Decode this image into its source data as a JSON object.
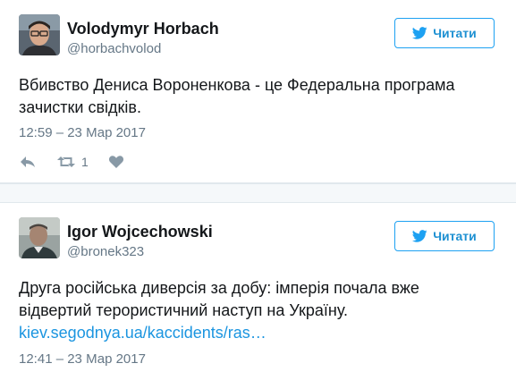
{
  "tweets": [
    {
      "display_name": "Volodymyr Horbach",
      "handle": "@horbachvolod",
      "follow_label": "Читати",
      "text": "Вбивство Дениса Вороненкова - це Федеральна програма зачистки свідків.",
      "link": "",
      "timestamp": "12:59 – 23 Мар 2017",
      "retweet_count": "1",
      "avatar_icon": "person-photo-avatar-icon"
    },
    {
      "display_name": "Igor Wojcechowski",
      "handle": "@bronek323",
      "follow_label": "Читати",
      "text": "Друга російська диверсія за добу: імперія почала вже відвертий терористичний наступ на Україну.",
      "link": "kiev.segodnya.ua/kaccidents/ras…",
      "timestamp": "12:41 – 23 Мар 2017",
      "avatar_icon": "person-photo-avatar-icon"
    }
  ],
  "colors": {
    "twitter_blue": "#1da1f2",
    "link_blue": "#1b95e0",
    "text_dark": "#14171a",
    "text_muted": "#657786",
    "icon_gray": "#8899a6",
    "separator_bg": "#f5f8fa"
  },
  "icons": {
    "follow": "twitter-bird-icon",
    "reply": "reply-arrow-icon",
    "retweet": "retweet-icon",
    "like": "heart-icon"
  }
}
